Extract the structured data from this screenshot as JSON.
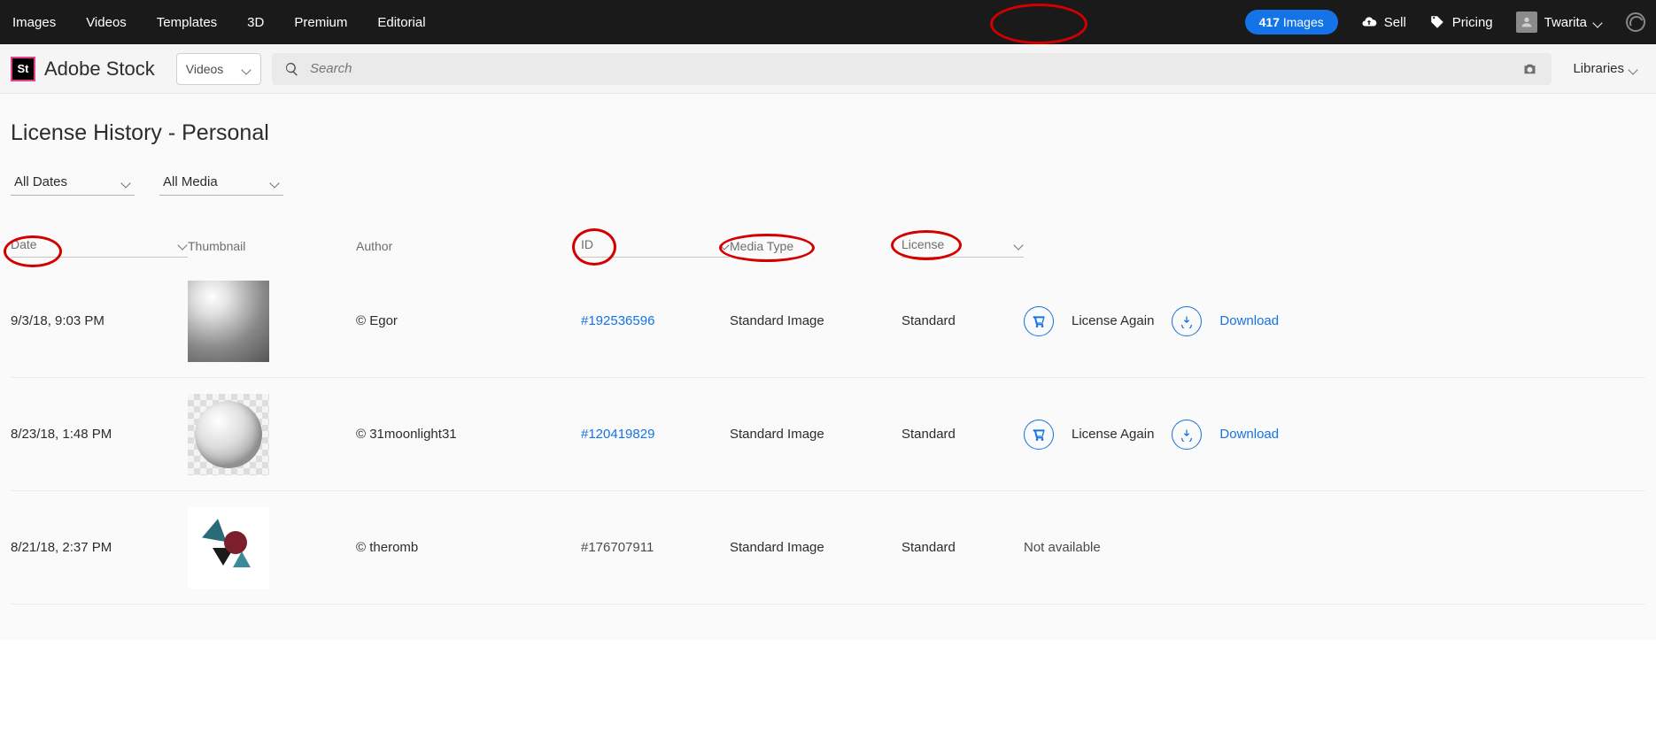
{
  "topnav": {
    "items": [
      "Images",
      "Videos",
      "Templates",
      "3D",
      "Premium",
      "Editorial"
    ],
    "images_btn_count": "417",
    "images_btn_label": "Images",
    "sell": "Sell",
    "pricing": "Pricing",
    "user": "Twarita"
  },
  "brand": {
    "badge": "St",
    "name": "Adobe Stock"
  },
  "search": {
    "category": "Videos",
    "placeholder": "Search",
    "libraries": "Libraries"
  },
  "page_title": "License History - Personal",
  "filters": {
    "dates": "All Dates",
    "media": "All Media"
  },
  "columns": {
    "date": "Date",
    "thumbnail": "Thumbnail",
    "author": "Author",
    "id": "ID",
    "media_type": "Media Type",
    "license": "License"
  },
  "actions": {
    "license_again": "License Again",
    "download": "Download",
    "not_available": "Not available"
  },
  "rows": [
    {
      "date": "9/3/18, 9:03 PM",
      "author": "© Egor",
      "id": "#192536596",
      "id_link": true,
      "media_type": "Standard Image",
      "license": "Standard",
      "available": true
    },
    {
      "date": "8/23/18, 1:48 PM",
      "author": "© 31moonlight31",
      "id": "#120419829",
      "id_link": true,
      "media_type": "Standard Image",
      "license": "Standard",
      "available": true
    },
    {
      "date": "8/21/18, 2:37 PM",
      "author": "© theromb",
      "id": "#176707911",
      "id_link": false,
      "media_type": "Standard Image",
      "license": "Standard",
      "available": false
    }
  ]
}
